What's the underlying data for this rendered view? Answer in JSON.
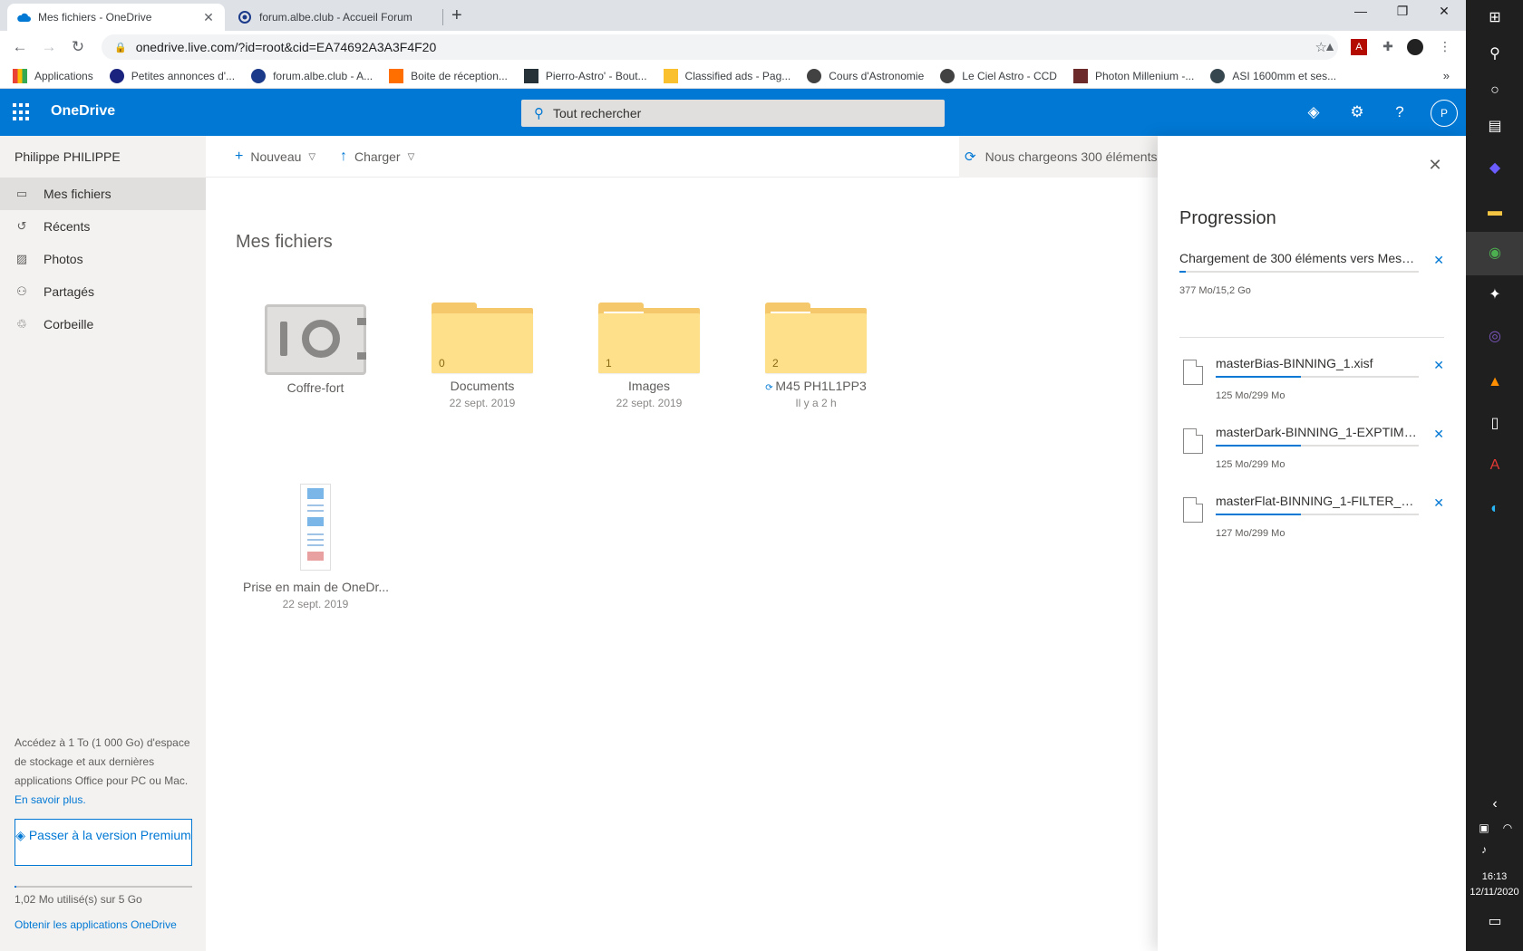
{
  "browser": {
    "tabs": [
      {
        "title": "Mes fichiers - OneDrive",
        "icon": "onedrive-cloud-icon",
        "color": "#0078d4"
      },
      {
        "title": "forum.albe.club - Accueil Forum",
        "icon": "forum-icon",
        "color": "#1b3a8a"
      }
    ],
    "url": "onedrive.live.com/?id=root&cid=EA74692A3A3F4F20",
    "bookmarks": [
      {
        "label": "Applications",
        "color": "#ea4335"
      },
      {
        "label": "Petites annonces d'...",
        "color": "#1a237e"
      },
      {
        "label": "forum.albe.club - A...",
        "color": "#1b3a8a"
      },
      {
        "label": "Boite de réception...",
        "color": "#ff6f00"
      },
      {
        "label": "Pierro-Astro' - Bout...",
        "color": "#263238"
      },
      {
        "label": "Classified ads - Pag...",
        "color": "#fbc02d"
      },
      {
        "label": "Cours d'Astronomie",
        "color": "#424242"
      },
      {
        "label": "Le Ciel Astro - CCD",
        "color": "#424242"
      },
      {
        "label": "Photon Millenium -...",
        "color": "#6d2a2a"
      },
      {
        "label": "ASI 1600mm et ses...",
        "color": "#37474f"
      }
    ]
  },
  "header": {
    "brand": "OneDrive",
    "search_placeholder": "Tout rechercher",
    "avatar_initial": "P",
    "brand_color": "#0078d4"
  },
  "sidebar": {
    "user": "Philippe PHILIPPE",
    "items": [
      {
        "label": "Mes fichiers",
        "icon": "folder-icon",
        "selected": true
      },
      {
        "label": "Récents",
        "icon": "history-icon"
      },
      {
        "label": "Photos",
        "icon": "photo-icon"
      },
      {
        "label": "Partagés",
        "icon": "shared-icon"
      },
      {
        "label": "Corbeille",
        "icon": "recycle-bin-icon"
      }
    ],
    "promo_text": "Accédez à 1 To (1 000 Go) d'espace de stockage et aux dernières applications Office pour PC ou Mac.",
    "promo_link": "En savoir plus.",
    "premium_button": "Passer à la version Premium",
    "storage_text": "1,02 Mo utilisé(s) sur 5 Go",
    "storage_used_fraction": 0.0002,
    "get_apps": "Obtenir les applications OneDrive"
  },
  "commands": {
    "new": "Nouveau",
    "upload": "Charger",
    "status": "Nous chargeons 300 éléments"
  },
  "main": {
    "title": "Mes fichiers",
    "items": [
      {
        "name": "Coffre-fort",
        "date": "",
        "type": "vault"
      },
      {
        "name": "Documents",
        "date": "22 sept. 2019",
        "type": "folder",
        "count": "0"
      },
      {
        "name": "Images",
        "date": "22 sept. 2019",
        "type": "folder",
        "count": "1"
      },
      {
        "name": "M45 PH1L1PP3",
        "date": "Il y a 2 h",
        "type": "folder",
        "count": "2"
      },
      {
        "name": "Prise en main de OneDr...",
        "date": "22 sept. 2019",
        "type": "document"
      }
    ]
  },
  "panel": {
    "title": "Progression",
    "overall": {
      "text": "Chargement de 300 éléments vers Mes fi...",
      "size": "377 Mo/15,2 Go",
      "progress_fraction": 0.025
    },
    "files": [
      {
        "name": "masterBias-BINNING_1.xisf",
        "size": "125 Mo/299 Mo",
        "progress_fraction": 0.42
      },
      {
        "name": "masterDark-BINNING_1-EXPTIME_...",
        "size": "125 Mo/299 Mo",
        "progress_fraction": 0.42
      },
      {
        "name": "masterFlat-BINNING_1-FILTER_1.xisf",
        "size": "127 Mo/299 Mo",
        "progress_fraction": 0.42
      }
    ]
  },
  "taskbar": {
    "time": "16:13",
    "date": "12/11/2020"
  }
}
